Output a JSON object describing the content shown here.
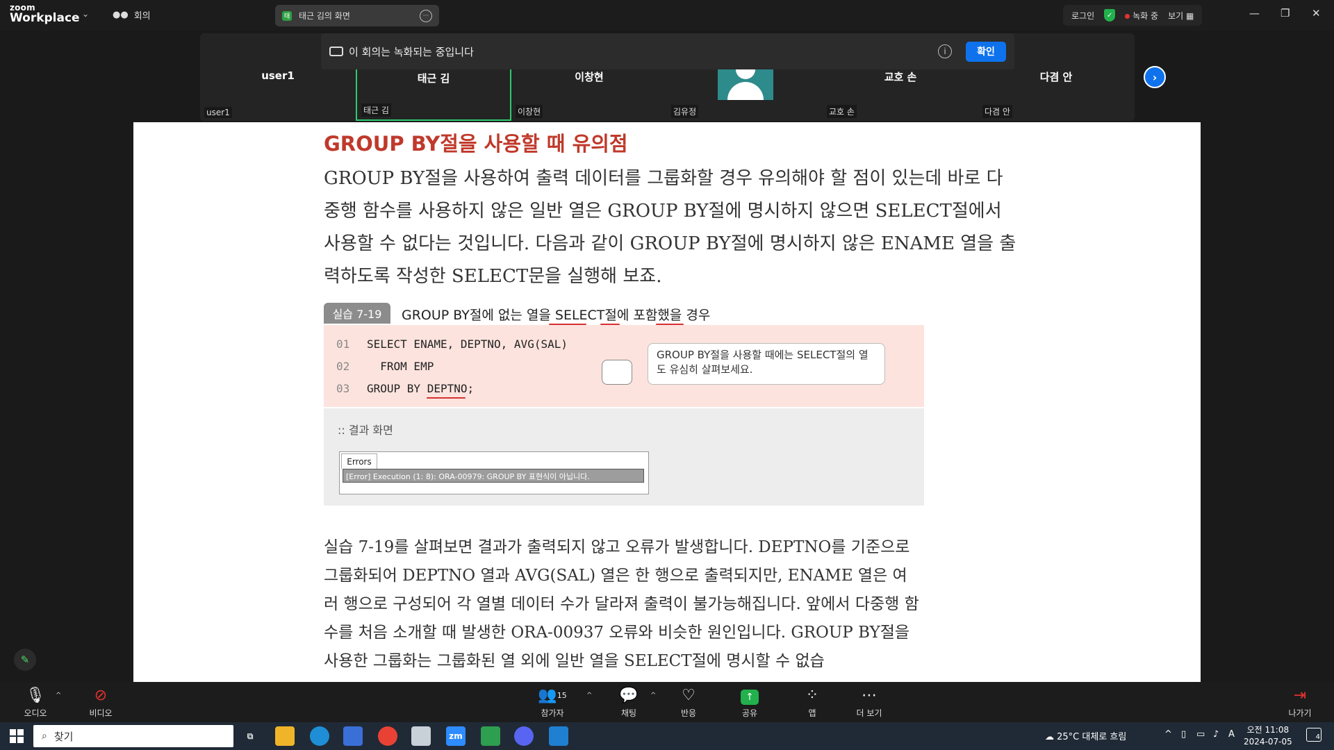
{
  "app": {
    "logo_small": "zoom",
    "logo_big": "Workplace",
    "meeting_label": "회의",
    "share_title": "태근 김의 화면",
    "login": "로그인",
    "recording": "녹화 중",
    "view": "보기"
  },
  "participants": [
    {
      "name": "user1",
      "label": "user1"
    },
    {
      "name": "태근 김",
      "label": "태근 김"
    },
    {
      "name": "이창현",
      "label": "이창현"
    },
    {
      "name": "",
      "label": "김유정"
    },
    {
      "name": "교호 손",
      "label": "교호 손"
    },
    {
      "name": "다겸 안",
      "label": "다겸 안"
    }
  ],
  "banner": {
    "text": "이 회의는 녹화되는 중입니다",
    "confirm": "확인"
  },
  "document": {
    "heading": "GROUP BY절을 사용할 때 유의점",
    "paragraph1": "GROUP BY절을 사용하여 출력 데이터를 그룹화할 경우 유의해야 할 점이 있는데 바로 다중행 함수를 사용하지 않은 일반 열은 GROUP BY절에 명시하지 않으면 SELECT절에서 사용할 수 없다는 것입니다. 다음과 같이 GROUP BY절에 명시하지 않은 ENAME 열을 출력하도록 작성한 SELECT문을 실행해 보죠.",
    "example_badge": "실습 7-19",
    "example_title": "GROUP BY절에 없는 열을 SELECT절에 포함했을 경우",
    "code": [
      {
        "ln": "01",
        "text": "SELECT ENAME, DEPTNO, AVG(SAL)"
      },
      {
        "ln": "02",
        "text": "  FROM EMP"
      },
      {
        "ln": "03",
        "text": "GROUP BY DEPTNO;"
      }
    ],
    "bubble": "GROUP BY절을 사용할 때에는 SELECT절의 열도 유심히 살펴보세요.",
    "result_title": ":: 결과 화면",
    "errors_tab": "Errors",
    "error_line": "[Error] Execution (1: 8): ORA-00979: GROUP BY 표현식이 아닙니다.",
    "paragraph2": "실습 7-19를 살펴보면 결과가 출력되지 않고 오류가 발생합니다. DEPTNO를 기준으로 그룹화되어 DEPTNO 열과 AVG(SAL) 열은 한 행으로 출력되지만, ENAME 열은 여러 행으로 구성되어 각 열별 데이터 수가 달라져 출력이 불가능해집니다. 앞에서 다중행 함수를 처음 소개할 때 발생한 ORA-00937 오류와 비슷한 원인입니다. GROUP BY절을 사용한 그룹화는 그룹화된 열 외에 일반 열을 SELECT절에 명시할 수 없습"
  },
  "controls": {
    "audio": "오디오",
    "video": "비디오",
    "participants": "참가자",
    "participant_count": "15",
    "chat": "채팅",
    "react": "반응",
    "share": "공유",
    "apps": "앱",
    "more": "더 보기",
    "leave": "나가기"
  },
  "taskbar": {
    "search": "찾기",
    "zoom_icon": "zm",
    "weather": "25°C  대체로 흐림",
    "ime": "A",
    "time": "오전 11:08",
    "date": "2024-07-05",
    "notifications": "4"
  },
  "colors": {
    "accent": "#0e72ed",
    "heading": "#c0392b",
    "active_speaker": "#2ecc71",
    "recording": "#e5322d"
  }
}
